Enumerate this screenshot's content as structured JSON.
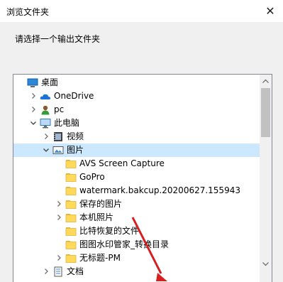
{
  "window": {
    "title": "浏览文件夹",
    "close_glyph": "✕"
  },
  "prompt": "请选择一个输出文件夹",
  "tree": {
    "items": [
      {
        "label": "桌面",
        "icon": "desktop-icon",
        "expander": "none"
      },
      {
        "label": "OneDrive",
        "icon": "onedrive-icon",
        "expander": "collapsed"
      },
      {
        "label": "pc",
        "icon": "user-icon",
        "expander": "collapsed"
      },
      {
        "label": "此电脑",
        "icon": "computer-icon",
        "expander": "expanded"
      },
      {
        "label": "视频",
        "icon": "video-folder-icon",
        "expander": "collapsed"
      },
      {
        "label": "图片",
        "icon": "pictures-folder-icon",
        "expander": "expanded",
        "selected": true
      },
      {
        "label": "AVS Screen Capture",
        "icon": "folder-icon",
        "expander": "none"
      },
      {
        "label": "GoPro",
        "icon": "folder-icon",
        "expander": "none"
      },
      {
        "label": "watermark.bakcup.20200627.155943",
        "icon": "folder-icon",
        "expander": "none"
      },
      {
        "label": "保存的图片",
        "icon": "folder-icon",
        "expander": "collapsed"
      },
      {
        "label": "本机照片",
        "icon": "folder-icon",
        "expander": "collapsed"
      },
      {
        "label": "比特恢复的文件",
        "icon": "folder-icon",
        "expander": "none"
      },
      {
        "label": "图图水印管家_转换目录",
        "icon": "folder-icon",
        "expander": "none"
      },
      {
        "label": "无标题-PM",
        "icon": "folder-icon",
        "expander": "collapsed"
      },
      {
        "label": "文档",
        "icon": "documents-folder-icon",
        "expander": "collapsed"
      }
    ]
  },
  "colors": {
    "selected": "#cce8ff",
    "folder": "#ffd95a",
    "annotation_arrow": "#e02020"
  }
}
